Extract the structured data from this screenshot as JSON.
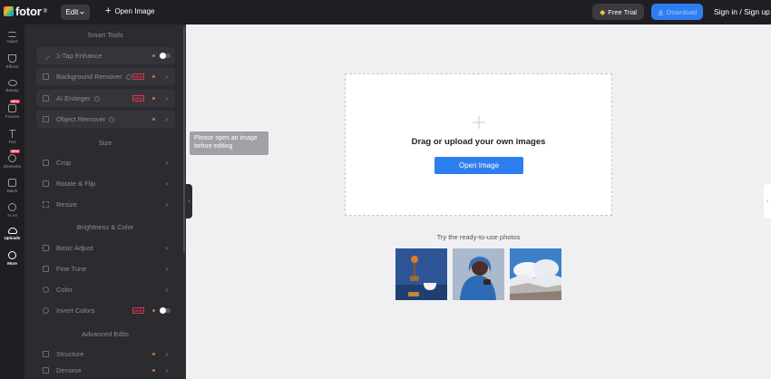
{
  "header": {
    "logo_text": "fotor",
    "logo_sup": "®",
    "edit_label": "Edit",
    "open_image_label": "Open Image",
    "free_trial_label": "Free Trial",
    "download_label": "Download",
    "signin_label": "Sign in / Sign up"
  },
  "rail": {
    "items": [
      {
        "label": "Adjust",
        "icon": "sliders-icon"
      },
      {
        "label": "Effects",
        "icon": "flask-icon"
      },
      {
        "label": "Beauty",
        "icon": "eye-icon"
      },
      {
        "label": "Frames",
        "icon": "frame-icon",
        "badge": "NEW"
      },
      {
        "label": "Text",
        "icon": "text-icon"
      },
      {
        "label": "Elements",
        "icon": "shapes-icon",
        "badge": "NEW"
      },
      {
        "label": "Batch",
        "icon": "batch-icon"
      },
      {
        "label": "AI Art",
        "icon": "ai-art-icon"
      },
      {
        "label": "Uploads",
        "icon": "upload-icon"
      },
      {
        "label": "More",
        "icon": "more-icon"
      }
    ]
  },
  "panel": {
    "smart_tools_title": "Smart Tools",
    "size_title": "Size",
    "brightness_title": "Brightness & Color",
    "advanced_title": "Advanced Edits",
    "new_badge": "NEW",
    "tools": {
      "one_tap": "1-Tap Enhance",
      "bg_remover": "Background Remover",
      "ai_enlarger": "AI Enlarger",
      "object_remover": "Object Remover",
      "crop": "Crop",
      "rotate": "Rotate & Flip",
      "resize": "Resize",
      "basic_adjust": "Basic Adjust",
      "fine_tune": "Fine Tune",
      "color": "Color",
      "invert": "Invert Colors",
      "structure": "Structure",
      "denoise": "Denoise"
    }
  },
  "tooltip": {
    "line1": "Please open an image",
    "line2": "before editing"
  },
  "canvas": {
    "drop_text": "Drag or upload your own images",
    "open_button": "Open Image",
    "try_text": "Try the ready-to-use photos"
  },
  "colors": {
    "accent": "#2d7ef0",
    "badge_red": "#e8344d",
    "panel_bg": "#2b2b30",
    "topbar_bg": "#1f1f23"
  }
}
